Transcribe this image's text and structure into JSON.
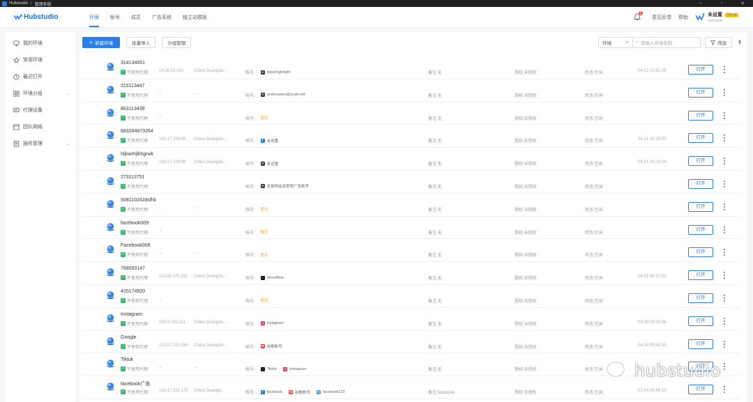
{
  "window": {
    "app_name": "Hubstudio",
    "section": "管理系统"
  },
  "topnav": {
    "logo": "Hubstudio",
    "tabs": [
      "环境",
      "帐号",
      "成员",
      "广告系统",
      "独立站模板"
    ],
    "active_tab": 0,
    "bell_count": "2",
    "link1": "意见反馈",
    "link2": "帮助",
    "user_name": "未设置",
    "user_tag": "团队版",
    "user_sub": "hubstudio"
  },
  "sidebar": {
    "items": [
      {
        "label": "我的环境",
        "icon": "monitor-icon"
      },
      {
        "label": "常用环境",
        "icon": "star-icon"
      },
      {
        "label": "最近打开",
        "icon": "clock-icon"
      },
      {
        "label": "环境分组",
        "icon": "grid-icon",
        "expand": true
      },
      {
        "label": "代理设备",
        "icon": "proxy-icon"
      },
      {
        "label": "团队网格",
        "icon": "team-icon"
      },
      {
        "label": "插件管理",
        "icon": "plugin-icon",
        "expand": true
      }
    ]
  },
  "toolbar": {
    "new_env": "新建环境",
    "batch_import": "批量导入",
    "group_manage": "分组管理",
    "env_select": "环境",
    "search_placeholder": "请输入环境名称",
    "filter": "筛选"
  },
  "labels": {
    "proxy": "不使用代理",
    "account": "帐号:",
    "note": "备注:",
    "auth": "授权:",
    "status": "状态:",
    "open": "打开"
  },
  "rows": [
    {
      "name": "314134051",
      "ip": "14.26.16.180",
      "loc": "China Guangdo...",
      "accounts": [
        {
          "text": "mpwrhghrtght",
          "kind": "web",
          "color": "#3a3a3a"
        }
      ],
      "note": "无",
      "auth": "未授权",
      "status": "空闲",
      "time": "04-22 13:42:29"
    },
    {
      "name": "315113447",
      "ip": "--",
      "loc": "--",
      "accounts": [
        {
          "text": "yeahouwen@yeah.net",
          "kind": "web",
          "color": "#3a3a3a"
        }
      ],
      "note": "无",
      "auth": "未授权",
      "status": "空闲",
      "time": ""
    },
    {
      "name": "863113439",
      "ip": "--",
      "loc": "",
      "accounts": [
        {
          "text": "暂无",
          "kind": "empty"
        }
      ],
      "note": "无",
      "auth": "未授权",
      "status": "空闲",
      "time": ""
    },
    {
      "name": "683264873264",
      "ip": "183.17.229.98",
      "loc": "China Guangdo...",
      "accounts": [
        {
          "text": "未设置",
          "kind": "f",
          "color": "#1877f2"
        }
      ],
      "note": "无",
      "auth": "未授权",
      "status": "空闲",
      "time": "04-21 16:18:02"
    },
    {
      "name": "hljkwrhjlkhgrwk",
      "ip": "183.17.229.98",
      "loc": "China Guangdo...",
      "accounts": [
        {
          "text": "未设置",
          "kind": "web",
          "color": "#3a3a3a"
        }
      ],
      "note": "无",
      "auth": "未授权",
      "status": "空闲",
      "time": "04-21 16:18:04"
    },
    {
      "name": "273113751",
      "ip": "",
      "loc": "",
      "accounts": [
        {
          "text": "全部他站名称将广告帐号",
          "kind": "web",
          "color": "#3a3a3a"
        }
      ],
      "note": "无",
      "auth": "未授权",
      "status": "空闲",
      "time": ""
    },
    {
      "name": "508110242dsfhk",
      "ip": "--",
      "loc": "--",
      "accounts": [
        {
          "text": "暂无",
          "kind": "empty"
        }
      ],
      "note": "无",
      "auth": "未授权",
      "status": "空闲",
      "time": ""
    },
    {
      "name": "facebook009",
      "ip": "--",
      "loc": "",
      "accounts": [
        {
          "text": "暂无",
          "kind": "empty"
        }
      ],
      "note": "无",
      "auth": "未授权",
      "status": "空闲",
      "time": ""
    },
    {
      "name": "Facebook008",
      "ip": "--",
      "loc": "--",
      "accounts": [
        {
          "text": "暂无",
          "kind": "empty"
        }
      ],
      "note": "无",
      "auth": "未授权",
      "status": "空闲",
      "time": ""
    },
    {
      "name": "768093147",
      "ip": "113.88.175.161",
      "loc": "China Guangdo...",
      "accounts": [
        {
          "text": "hfrooffhilo",
          "kind": "t",
          "color": "#111111"
        }
      ],
      "note": "无",
      "auth": "未授权",
      "status": "空闲",
      "time": "04-02 06:27:03"
    },
    {
      "name": "420174920",
      "ip": "--",
      "loc": "",
      "accounts": [
        {
          "text": "暂无",
          "kind": "empty"
        }
      ],
      "note": "无",
      "auth": "未授权",
      "status": "空闲",
      "time": ""
    },
    {
      "name": "Instagram",
      "ip": "183.8.190.211",
      "loc": "China Guangdo...",
      "accounts": [
        {
          "text": "instagram",
          "kind": "i",
          "color": "#e1306c"
        }
      ],
      "note": "无",
      "auth": "未授权",
      "status": "空闲",
      "time": "03-08 09:29:08"
    },
    {
      "name": "Google",
      "ip": "113.87.225.190",
      "loc": "China Guangdo...",
      "accounts": [
        {
          "text": "谷歌帐号",
          "kind": "m",
          "color": "#ea4335"
        }
      ],
      "note": "无",
      "auth": "未授权",
      "status": "空闲",
      "time": "04-15 09:50:33"
    },
    {
      "name": "Tiktok",
      "ip": "--",
      "loc": "--",
      "accounts": [
        {
          "text": "Tiktok",
          "kind": "t",
          "color": "#111111"
        },
        {
          "text": "instagram",
          "kind": "i",
          "color": "#e1306c"
        }
      ],
      "note": "无",
      "auth": "未授权",
      "status": "空闲",
      "time": ""
    },
    {
      "name": "facebook广告",
      "ip": "183.17.231.175",
      "loc": "China Guangd...",
      "accounts": [
        {
          "text": "facebook",
          "kind": "f",
          "color": "#1877f2"
        },
        {
          "text": "谷歌帐号",
          "kind": "m",
          "color": "#ea4335"
        },
        {
          "text": "facebook123",
          "kind": "web",
          "color": "#4aa3df"
        }
      ],
      "note": "facebook",
      "auth": "未授权",
      "status": "空闲",
      "time": "02-24 09:49:13"
    }
  ],
  "watermark": "hubstudio",
  "colors": {
    "accent": "#2b7de9",
    "green": "#2fbd6c",
    "empty_orange": "#f5a623"
  }
}
